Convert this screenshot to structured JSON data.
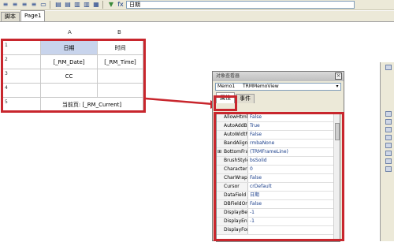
{
  "toolbar": {
    "field_text": "日期",
    "icons": [
      "align-left-icon",
      "align-center-icon",
      "align-right-icon",
      "align-justify-icon",
      "frame-icon",
      "frame-top-icon",
      "frame-bottom-icon",
      "frame-left-icon",
      "frame-right-icon",
      "fill-icon",
      "dropdown-icon"
    ]
  },
  "tabs": [
    {
      "label": "脚本"
    },
    {
      "label": "Page1"
    }
  ],
  "columns": [
    {
      "label": "A"
    },
    {
      "label": "B"
    }
  ],
  "rows": [
    {
      "num": "1",
      "a": "日期",
      "b": "时间"
    },
    {
      "num": "2",
      "a": "[_RM_Date]",
      "b": "[_RM_Time]"
    },
    {
      "num": "3",
      "a": "CC",
      "b": ""
    },
    {
      "num": "4",
      "a": "",
      "b": ""
    },
    {
      "num": "5",
      "merged": "当前页: [_RM_Current]"
    }
  ],
  "dialog": {
    "title": "对象查看器",
    "combo_key": "Memo1",
    "combo_value": "TRMMemoView",
    "tabs": [
      {
        "label": "属性"
      },
      {
        "label": "事件"
      }
    ],
    "properties": [
      {
        "k": "AllowHtmlT",
        "v": "False"
      },
      {
        "k": "AutoAddBla",
        "v": "True"
      },
      {
        "k": "AutoWidth",
        "v": "False"
      },
      {
        "k": "BandAlign",
        "v": "rmbaNone"
      },
      {
        "k": "BottomFram",
        "v": "(TRMFrameLine)",
        "expand": "⊞"
      },
      {
        "k": "BrushStyle",
        "v": "bsSolid"
      },
      {
        "k": "CharacterS",
        "v": "0"
      },
      {
        "k": "CharWrap",
        "v": "False"
      },
      {
        "k": "Cursor",
        "v": "crDefault"
      },
      {
        "k": "DataField",
        "v": "日期"
      },
      {
        "k": "DBFieldOnl",
        "v": "False"
      },
      {
        "k": "DisplayBeg",
        "v": "-1"
      },
      {
        "k": "DisplayEnd",
        "v": "-1"
      },
      {
        "k": "DisplayFor",
        "v": ""
      }
    ]
  },
  "colors": {
    "highlight": "#c8262d",
    "selected_cell": "#c8d4ec"
  }
}
